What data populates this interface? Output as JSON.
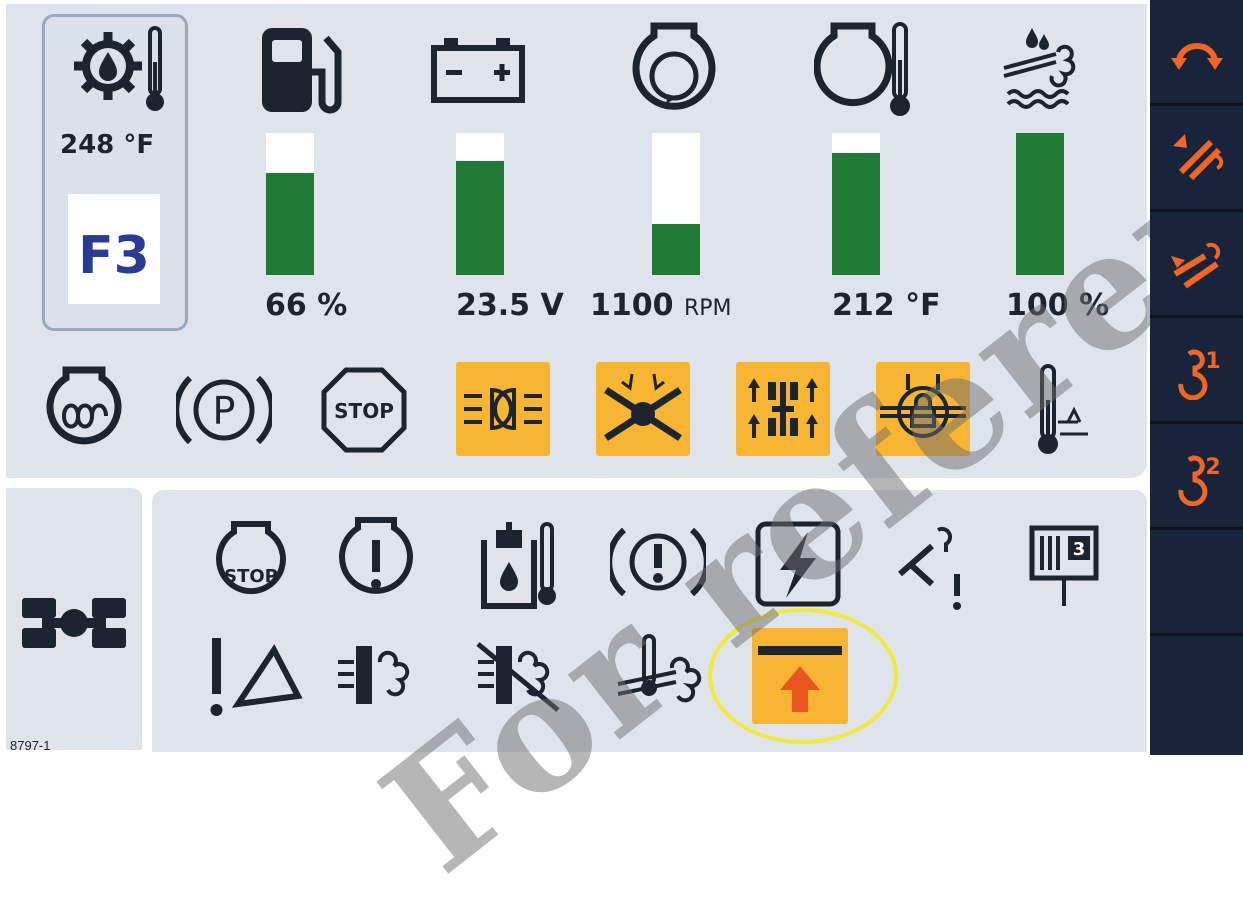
{
  "gauges": {
    "trans_oil_temp": {
      "value": "248 °F",
      "icon": "transmission-oil-temp-icon"
    },
    "fuel": {
      "value": "66 %",
      "fraction": 0.66,
      "icon": "fuel-pump-icon"
    },
    "battery": {
      "value": "23.5 V",
      "fraction": 0.8,
      "icon": "battery-icon"
    },
    "engine_rpm": {
      "value": "1100",
      "unit": "RPM",
      "fraction": 0.36,
      "icon": "engine-rpm-icon"
    },
    "coolant_temp": {
      "value": "212 °F",
      "fraction": 0.86,
      "icon": "engine-coolant-temp-icon"
    },
    "def_level": {
      "value": "100 %",
      "fraction": 1.0,
      "icon": "def-fluid-icon"
    }
  },
  "gear": {
    "label": "F3"
  },
  "colors": {
    "panel": "#dfe4ec",
    "icon": "#1c2430",
    "bar_fill": "#1f7a36",
    "warning_bg": "#f7b531",
    "sidebar": "#17243a",
    "sidebar_icon": "#f26522",
    "highlight": "#f2ea3a"
  },
  "indicators_row": [
    "glow-plug-icon",
    "parking-brake-icon",
    "stop-icon",
    "work-lights-icon",
    "differential-lock-off-icon",
    "all-wheel-steer-icon",
    "differential-lock-icon",
    "ambient-temp-icon"
  ],
  "warnings_row1": [
    "engine-stop-icon",
    "engine-warning-icon",
    "hydraulic-oil-temp-icon",
    "brake-warning-icon",
    "electrical-fault-icon",
    "implement-warning-icon",
    "winch-layer-icon"
  ],
  "warnings_row2": [
    "boom-warning-icon",
    "exhaust-filter-icon",
    "exhaust-filter-off-icon",
    "exhaust-temp-icon",
    "boom-raise-warning-icon"
  ],
  "sidebar": [
    "swing-icon",
    "boom-extend-icon",
    "boom-retract-icon",
    "hook-1-icon",
    "hook-2-icon"
  ],
  "sidebar_labels": {
    "hook1": "1",
    "hook2": "2"
  },
  "footer": {
    "figure_id": "8797-1"
  },
  "watermark": {
    "text": "For reference"
  }
}
